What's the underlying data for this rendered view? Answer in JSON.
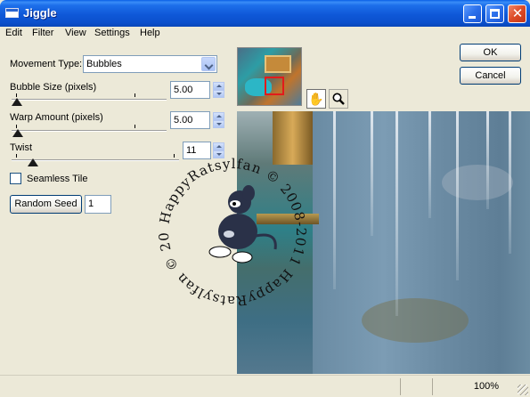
{
  "window": {
    "title": "Jiggle"
  },
  "menu": [
    "Edit",
    "Filter",
    "View",
    "Settings",
    "Help"
  ],
  "controls": {
    "movement_type_label": "Movement Type:",
    "movement_type_value": "Bubbles",
    "bubble_size_label": "Bubble Size (pixels)",
    "bubble_size_value": "5.00",
    "warp_amount_label": "Warp Amount (pixels)",
    "warp_amount_value": "5.00",
    "twist_label": "Twist",
    "twist_value": "11",
    "seamless_tile_label": "Seamless Tile",
    "random_seed_label": "Random Seed",
    "random_seed_value": "1"
  },
  "buttons": {
    "ok": "OK",
    "cancel": "Cancel"
  },
  "tools": {
    "pan": "pan-hand-icon",
    "zoom": "magnifier-icon"
  },
  "watermark_text": "HappyRatsylfan © 2008-2011",
  "status": {
    "zoom": "100%"
  }
}
